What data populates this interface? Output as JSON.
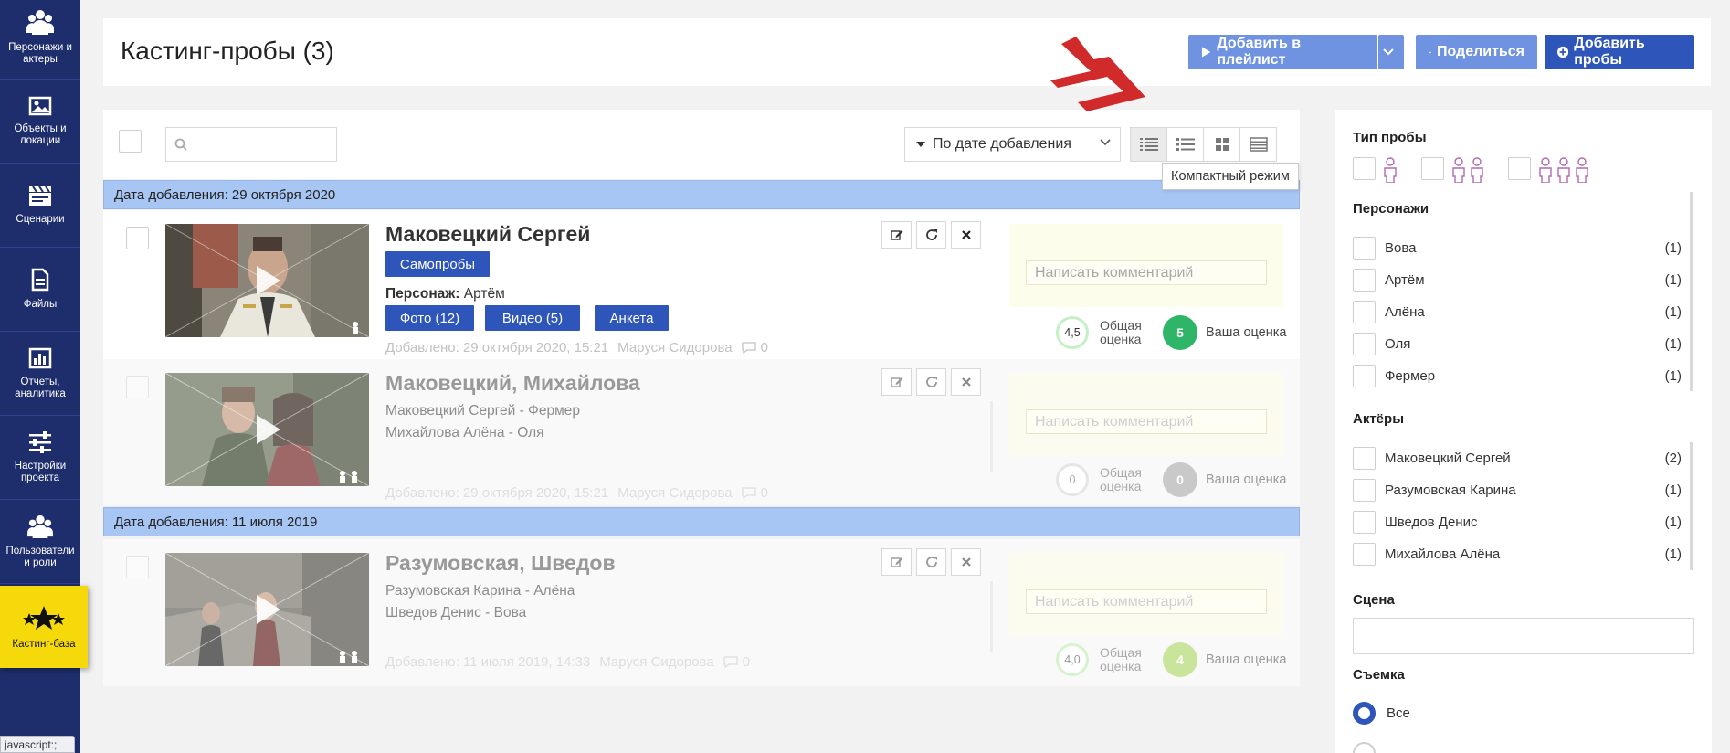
{
  "sidebar": {
    "items": [
      {
        "label": "Персонажи и актеры",
        "icon": "people-icon"
      },
      {
        "label": "Объекты и локации",
        "icon": "image-icon"
      },
      {
        "label": "Сценарии",
        "icon": "clapperboard-icon"
      },
      {
        "label": "Файлы",
        "icon": "file-icon"
      },
      {
        "label": "Отчеты, аналитика",
        "icon": "chart-icon"
      },
      {
        "label": "Настройки проекта",
        "icon": "sliders-icon"
      },
      {
        "label": "Пользователи и роли",
        "icon": "users-icon"
      },
      {
        "label": "Кастинг-база",
        "icon": "stars-icon",
        "active": true
      }
    ],
    "status_text": "javascript:;"
  },
  "header": {
    "title": "Кастинг-пробы (3)",
    "playlist_label": "Добавить в плейлист",
    "share_label": "Поделиться",
    "add_label": "Добавить пробы"
  },
  "toolbar": {
    "search_value": "",
    "sort_label": "По дате добавления",
    "tooltip": "Компактный режим"
  },
  "groups": [
    {
      "label": "Дата добавления: 29 октября 2020"
    },
    {
      "label": "Дата добавления: 11 июля 2019"
    }
  ],
  "cards": [
    {
      "title": "Маковецкий Сергей",
      "tag": "Самопробы",
      "role_prefix": "Персонаж:",
      "role_value": "Артём",
      "photo_btn": "Фото (12)",
      "video_btn": "Видео (5)",
      "form_btn": "Анкета",
      "added": "Добавлено: 29 октября 2020, 15:21",
      "author": "Маруся Сидорова",
      "comments": "0",
      "comment_placeholder": "Написать комментарий",
      "overall": "4,5",
      "overall_label_1": "Общая",
      "overall_label_2": "оценка",
      "your": "5",
      "your_label": "Ваша оценка",
      "your_color": "#2fb567"
    },
    {
      "title": "Маковецкий, Михайлова",
      "line1": "Маковецкий Сергей - Фермер",
      "line2": "Михайлова Алёна - Оля",
      "added": "Добавлено: 29 октября 2020, 15:21",
      "author": "Маруся Сидорова",
      "comments": "0",
      "comment_placeholder": "Написать комментарий",
      "overall": "0",
      "overall_label_1": "Общая",
      "overall_label_2": "оценка",
      "your": "0",
      "your_label": "Ваша оценка",
      "your_color": "#c9c9c9"
    },
    {
      "title": "Разумовская, Шведов",
      "line1": "Разумовская Карина - Алёна",
      "line2": "Шведов Денис - Вова",
      "added": "Добавлено: 11 июля 2019, 14:33",
      "author": "Маруся Сидорова",
      "comments": "0",
      "comment_placeholder": "Написать комментарий",
      "overall": "4,0",
      "overall_label_1": "Общая",
      "overall_label_2": "оценка",
      "your": "4",
      "your_label": "Ваша оценка",
      "your_color": "#c9e59b"
    }
  ],
  "filters": {
    "type_title": "Тип пробы",
    "characters_title": "Персонажи",
    "characters": [
      {
        "name": "Вова",
        "count": "(1)"
      },
      {
        "name": "Артём",
        "count": "(1)"
      },
      {
        "name": "Алёна",
        "count": "(1)"
      },
      {
        "name": "Оля",
        "count": "(1)"
      },
      {
        "name": "Фермер",
        "count": "(1)"
      }
    ],
    "actors_title": "Актёры",
    "actors": [
      {
        "name": "Маковецкий Сергей",
        "count": "(2)"
      },
      {
        "name": "Разумовская Карина",
        "count": "(1)"
      },
      {
        "name": "Шведов Денис",
        "count": "(1)"
      },
      {
        "name": "Михайлова Алёна",
        "count": "(1)"
      }
    ],
    "scene_title": "Сцена",
    "scene_value": "",
    "shoot_title": "Съемка",
    "shoot_option_all": "Все"
  },
  "colors": {
    "sidebar_bg": "#1e2d6b",
    "accent": "#2e55b9",
    "accent_light": "#6f93e0",
    "group_bg": "#a8c6f3",
    "active_nav": "#f5d90a",
    "decoration_red": "#d12a2a"
  }
}
